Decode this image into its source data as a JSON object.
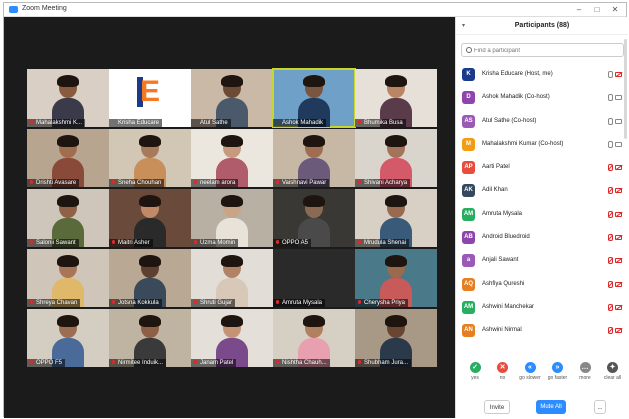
{
  "window": {
    "title": "Zoom Meeting"
  },
  "panel": {
    "title": "Participants (88)",
    "search_placeholder": "Find a participant",
    "participants": [
      {
        "initials": "K",
        "name": "Krisha Educare (Host, me)",
        "color": "#1b3a8c",
        "mic_muted": false,
        "cam_off": true
      },
      {
        "initials": "D",
        "name": "Ashok Mahadik (Co-host)",
        "color": "#8e44ad",
        "mic_muted": false,
        "cam_off": false
      },
      {
        "initials": "AS",
        "name": "Atul Sathe (Co-host)",
        "color": "#9b59b6",
        "mic_muted": false,
        "cam_off": false
      },
      {
        "initials": "M",
        "name": "Mahalakshmi Kumar (Co-host)",
        "color": "#f39c12",
        "mic_muted": false,
        "cam_off": false
      },
      {
        "initials": "AP",
        "name": "Aarti Patel",
        "color": "#e74c3c",
        "mic_muted": true,
        "cam_off": true
      },
      {
        "initials": "AK",
        "name": "Adil Khan",
        "color": "#34495e",
        "mic_muted": true,
        "cam_off": true
      },
      {
        "initials": "AM",
        "name": "Amruta Mysala",
        "color": "#27ae60",
        "mic_muted": true,
        "cam_off": true
      },
      {
        "initials": "AB",
        "name": "Android Bluedroid",
        "color": "#8e44ad",
        "mic_muted": true,
        "cam_off": true
      },
      {
        "initials": "a",
        "name": "Anjali Sawant",
        "color": "#9b59b6",
        "mic_muted": true,
        "cam_off": true
      },
      {
        "initials": "AQ",
        "name": "Ashfiya Qureshi",
        "color": "#e67e22",
        "mic_muted": true,
        "cam_off": true
      },
      {
        "initials": "AM",
        "name": "Ashwini Manchekar",
        "color": "#27ae60",
        "mic_muted": true,
        "cam_off": true
      },
      {
        "initials": "AN",
        "name": "Ashwini Nirmal",
        "color": "#e67e22",
        "mic_muted": true,
        "cam_off": true
      }
    ],
    "reactions": [
      {
        "label": "yes",
        "glyph": "✓",
        "color": "#27ae60"
      },
      {
        "label": "no",
        "glyph": "✕",
        "color": "#e74c3c"
      },
      {
        "label": "go slower",
        "glyph": "«",
        "color": "#2d8cff"
      },
      {
        "label": "go faster",
        "glyph": "»",
        "color": "#2d8cff"
      },
      {
        "label": "more",
        "glyph": "…",
        "color": "#888888"
      },
      {
        "label": "clear all",
        "glyph": "✦",
        "color": "#555555"
      }
    ],
    "invite_label": "Invite",
    "mute_all_label": "Mute All",
    "more_label": "..."
  },
  "tiles": [
    {
      "name": "Mahalakshmi K...",
      "bg": "#d9cfc4",
      "skin": "#8a5a3c",
      "shirt": "#3a3a4a",
      "muted": true
    },
    {
      "name": "Krisha Educare",
      "logo": true,
      "muted": false
    },
    {
      "name": "Atul Sathe",
      "bg": "#c9b9a6",
      "skin": "#6d4a34",
      "shirt": "#4b5a6a",
      "muted": false
    },
    {
      "name": "Ashok Mahadik",
      "bg": "#6fa0c8",
      "skin": "#7a5540",
      "shirt": "#1f3a5c",
      "muted": false,
      "active": true
    },
    {
      "name": "Bhumika Busa",
      "bg": "#e6e0d8",
      "skin": "#b98565",
      "shirt": "#5a3b4a",
      "muted": true
    },
    {
      "name": "Drishti Avasare",
      "bg": "#b7a58f",
      "skin": "#a06d4e",
      "shirt": "#8a4a3a",
      "muted": true
    },
    {
      "name": "Sneha Chouhan",
      "bg": "#d2c6b5",
      "skin": "#a87a5c",
      "shirt": "#c98f5a",
      "muted": true
    },
    {
      "name": "neelam arora",
      "bg": "#ece7de",
      "skin": "#c69a7d",
      "shirt": "#b05c6b",
      "muted": true
    },
    {
      "name": "Vaishnavi Pawar",
      "bg": "#c7b8a6",
      "skin": "#9f6e51",
      "shirt": "#6b5a7a",
      "muted": true
    },
    {
      "name": "Shivani Acharya",
      "bg": "#d9d4cc",
      "skin": "#a3745a",
      "shirt": "#d45a6a",
      "muted": true
    },
    {
      "name": "Salonii Sawant",
      "bg": "#cfc6bb",
      "skin": "#8f6248",
      "shirt": "#5a6a3a",
      "muted": true
    },
    {
      "name": "Maitri Asher",
      "bg": "#6a4a3a",
      "skin": "#c08a68",
      "shirt": "#2a2a2a",
      "muted": true
    },
    {
      "name": "Uzma Momin",
      "bg": "#b9b0a4",
      "skin": "#c9a588",
      "shirt": "#e8e2d8",
      "muted": true
    },
    {
      "name": "OPPO A5",
      "bg": "#3a3834",
      "skin": "#8a6a52",
      "shirt": "#4a4a4a",
      "muted": true
    },
    {
      "name": "Mrudula Shenai",
      "bg": "#d8d0c4",
      "skin": "#9a6a50",
      "shirt": "#3a5a7a",
      "muted": true
    },
    {
      "name": "Shreya Chavan",
      "bg": "#cfc5b8",
      "skin": "#a87556",
      "shirt": "#e0b86a",
      "muted": true
    },
    {
      "name": "Jotsna Kokkula",
      "bg": "#b8a894",
      "skin": "#5e4030",
      "shirt": "#3a4a5a",
      "muted": true
    },
    {
      "name": "Shruti Gujar",
      "bg": "#e2ddd6",
      "skin": "#b08366",
      "shirt": "#d8c8b8",
      "muted": true
    },
    {
      "name": "Amruta Mysala",
      "bg": "#2a2a2a",
      "skin": "#2a2a2a",
      "shirt": "#2a2a2a",
      "muted": true,
      "empty": true
    },
    {
      "name": "Cherysha Priya",
      "bg": "#4a7a8a",
      "skin": "#9a6a4e",
      "shirt": "#c85a5a",
      "muted": true
    },
    {
      "name": "OPPO F5",
      "bg": "#d4cdc2",
      "skin": "#9c6d50",
      "shirt": "#4a6a9a",
      "muted": true
    },
    {
      "name": "Nirmitee Induik...",
      "bg": "#bfb3a2",
      "skin": "#8e5f44",
      "shirt": "#3a3a3a",
      "muted": true
    },
    {
      "name": "Janam Patel",
      "bg": "#e4dfd8",
      "skin": "#c49474",
      "shirt": "#7a4a8a",
      "muted": true
    },
    {
      "name": "Nishtha Chauh...",
      "bg": "#d6cfc3",
      "skin": "#b0805f",
      "shirt": "#e8a0b0",
      "muted": true
    },
    {
      "name": "Shubham Jura...",
      "bg": "#a89886",
      "skin": "#6a4632",
      "shirt": "#2a3a4a",
      "muted": true
    }
  ]
}
